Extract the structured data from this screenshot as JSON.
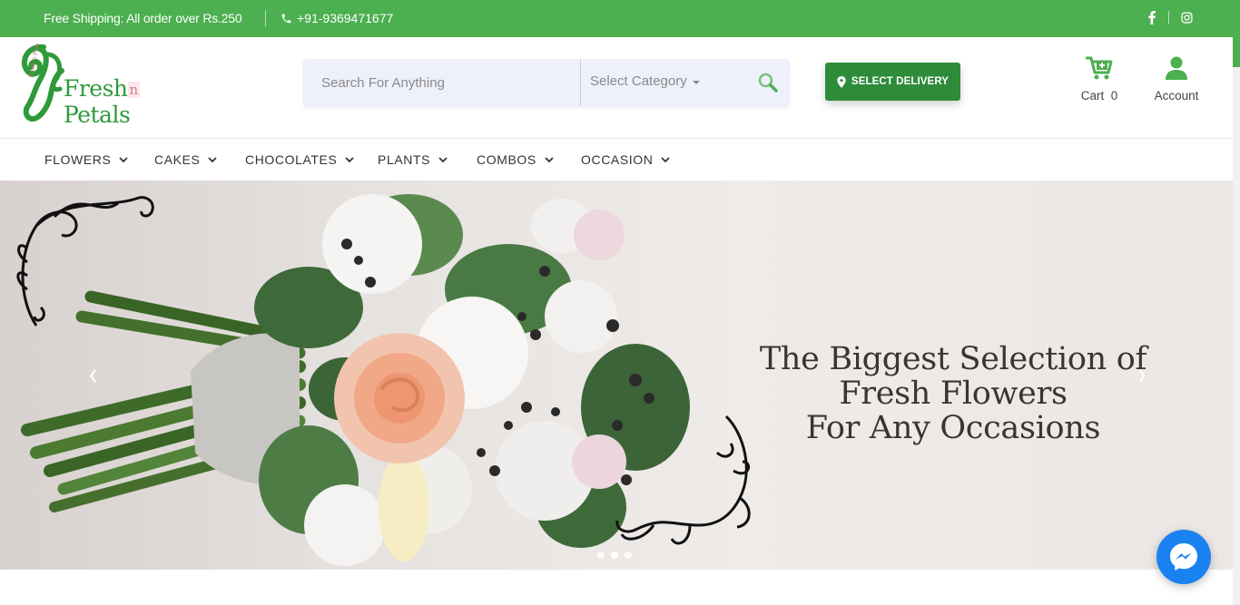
{
  "topbar": {
    "shipping_text": "Free Shipping: All order over Rs.250",
    "phone": "+91-9369471677",
    "social": [
      "facebook-icon",
      "instagram-icon"
    ],
    "background": "#4caf50"
  },
  "header": {
    "logo_text_left": "Fresh",
    "logo_text_mid": "n",
    "logo_text_right": "Petals",
    "logo_tagline": "Fresh n Petals",
    "search": {
      "placeholder": "Search For Anything",
      "category_label": "Select Category"
    },
    "delivery_button": "SELECT DELIVERY",
    "cart_label": "Cart",
    "cart_count": "0",
    "account_label": "Account"
  },
  "nav": {
    "items": [
      {
        "label": "FLOWERS"
      },
      {
        "label": "CAKES"
      },
      {
        "label": "CHOCOLATES"
      },
      {
        "label": "PLANTS"
      },
      {
        "label": "COMBOS"
      },
      {
        "label": "OCCASION"
      }
    ]
  },
  "hero": {
    "line1": "The Biggest Selection of",
    "line2": "Fresh Flowers",
    "line3": "For Any Occasions",
    "slides_total": 3,
    "active_slide": 2
  },
  "colors": {
    "brand_green": "#4caf50",
    "dark_green": "#2e8b3a",
    "messenger_blue": "#1a82f0"
  }
}
